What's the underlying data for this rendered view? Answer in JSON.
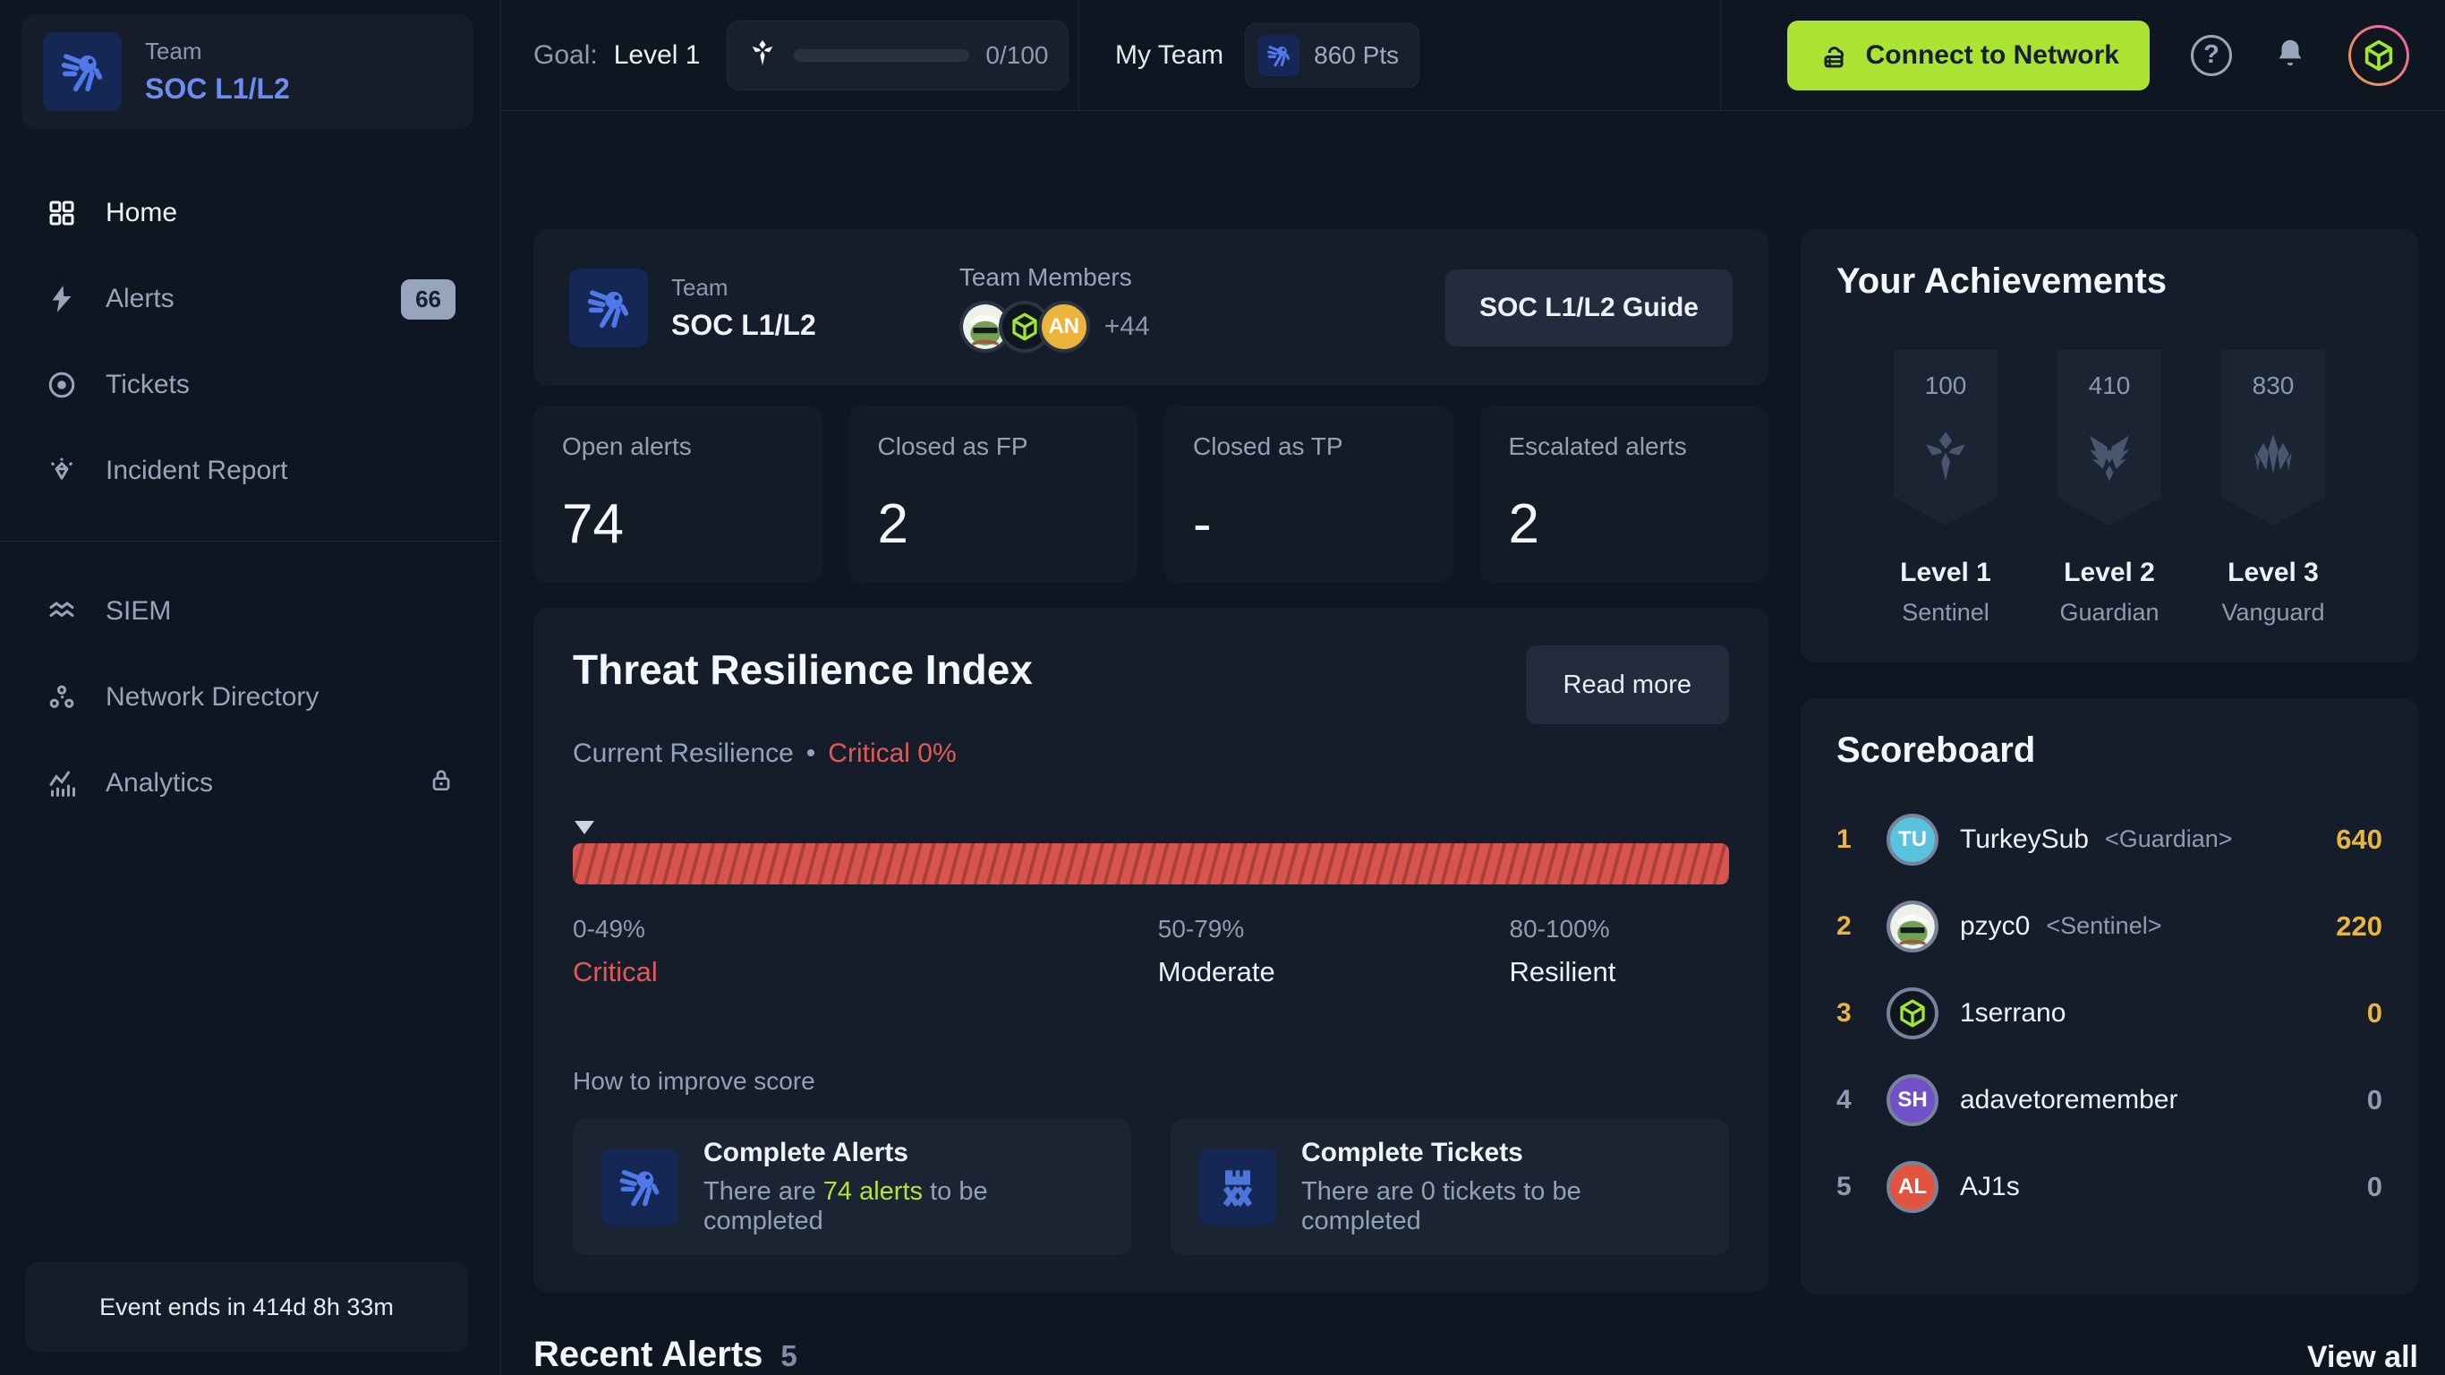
{
  "colors": {
    "lime": "#b3e338",
    "lime_button": "#abe334",
    "red": "#e15a55",
    "gold": "#e9b440",
    "muted": "#8e9bb1",
    "white": "#eef2f7",
    "blue_accent": "#6d8df0"
  },
  "sidebar": {
    "team_label": "Team",
    "team_name": "SOC L1/L2",
    "nav": [
      {
        "label": "Home",
        "icon": "grid-icon",
        "active": true
      },
      {
        "label": "Alerts",
        "icon": "bolt-icon",
        "badge": "66"
      },
      {
        "label": "Tickets",
        "icon": "target-icon"
      },
      {
        "label": "Incident Report",
        "icon": "gem-icon"
      },
      {
        "label": "SIEM",
        "icon": "waves-icon"
      },
      {
        "label": "Network Directory",
        "icon": "nodes-icon"
      },
      {
        "label": "Analytics",
        "icon": "chart-icon",
        "locked": true
      }
    ],
    "event_note": "Event ends in 414d 8h 33m"
  },
  "topbar": {
    "goal_label": "Goal:",
    "goal_value": "Level 1",
    "goal_progress": "0/100",
    "my_team_label": "My Team",
    "team_points": "860 Pts",
    "connect_button": "Connect to Network",
    "help_glyph": "?"
  },
  "team_header": {
    "team_label": "Team",
    "team_name": "SOC L1/L2",
    "members_label": "Team Members",
    "members": [
      {
        "type": "pepe"
      },
      {
        "type": "cube"
      },
      {
        "type": "initials",
        "initials": "AN",
        "avatar_color": "#ecb43d"
      }
    ],
    "members_more": "+44",
    "guide_button": "SOC L1/L2 Guide"
  },
  "stats": {
    "cards": [
      {
        "label": "Open alerts",
        "value": "74"
      },
      {
        "label": "Closed as FP",
        "value": "2"
      },
      {
        "label": "Closed as TP",
        "value": "-"
      },
      {
        "label": "Escalated alerts",
        "value": "2"
      }
    ]
  },
  "tri": {
    "title": "Threat Resilience Index",
    "subtitle_label": "Current Resilience",
    "separator": "•",
    "status": "Critical 0%",
    "read_more": "Read more",
    "ranges": [
      {
        "range": "0-49%",
        "state": "Critical",
        "state_color": "#e15a55",
        "left": "0%"
      },
      {
        "range": "50-79%",
        "state": "Moderate",
        "state_color": "#eef2f7",
        "left": "50.6%"
      },
      {
        "range": "80-100%",
        "state": "Resilient",
        "state_color": "#eef2f7",
        "left": "81%"
      }
    ],
    "improve_label": "How to improve score",
    "improve": [
      {
        "title": "Complete Alerts",
        "sub_prefix": "There are ",
        "sub_highlight": "74 alerts",
        "sub_suffix": " to be completed",
        "icon": "team-bird-icon"
      },
      {
        "title": "Complete Tickets",
        "sub_prefix": "There are 0 tickets to be completed",
        "sub_highlight": "",
        "sub_suffix": "",
        "icon": "castle-icon"
      }
    ]
  },
  "achievements": {
    "title": "Your Achievements",
    "items": [
      {
        "points": "100",
        "level": "Level 1",
        "rank": "Sentinel",
        "icon": "sentinel-emblem-icon"
      },
      {
        "points": "410",
        "level": "Level 2",
        "rank": "Guardian",
        "icon": "guardian-emblem-icon"
      },
      {
        "points": "830",
        "level": "Level 3",
        "rank": "Vanguard",
        "icon": "vanguard-emblem-icon"
      }
    ]
  },
  "scoreboard": {
    "title": "Scoreboard",
    "rows": [
      {
        "rank": "1",
        "rank_color": "#e9b440",
        "type": "initials",
        "initials": "TU",
        "avatar_color": "#59c3de",
        "name": "TurkeySub",
        "title": "<Guardian>",
        "score": "640",
        "score_color": "#e9b440"
      },
      {
        "rank": "2",
        "rank_color": "#e9b440",
        "type": "pepe",
        "name": "pzyc0",
        "title": "<Sentinel>",
        "score": "220",
        "score_color": "#e9b440"
      },
      {
        "rank": "3",
        "rank_color": "#e9b440",
        "type": "cube",
        "name": "1serrano",
        "title": "",
        "score": "0",
        "score_color": "#e9b440"
      },
      {
        "rank": "4",
        "rank_color": "#8e9bb1",
        "type": "initials",
        "initials": "SH",
        "avatar_color": "#7150c8",
        "name": "adavetoremember",
        "title": "",
        "score": "0",
        "score_color": "#8e9bb1"
      },
      {
        "rank": "5",
        "rank_color": "#8e9bb1",
        "type": "initials",
        "initials": "AL",
        "avatar_color": "#e2543d",
        "name": "AJ1s",
        "title": "",
        "score": "0",
        "score_color": "#8e9bb1"
      }
    ]
  },
  "recent": {
    "title": "Recent Alerts",
    "count": "5",
    "view_all": "View all"
  }
}
